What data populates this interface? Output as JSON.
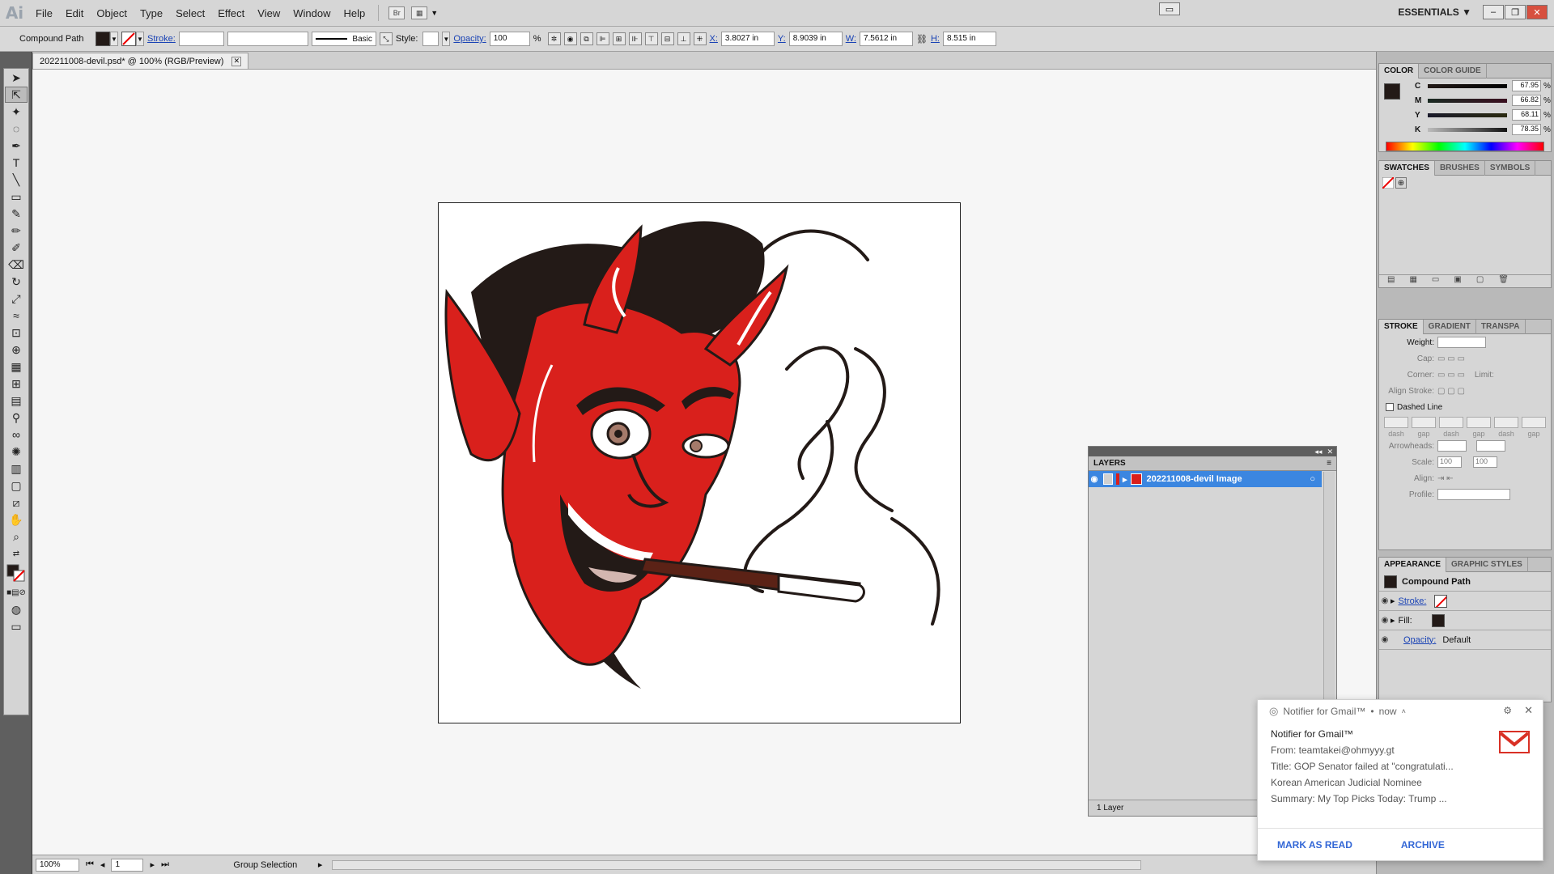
{
  "menubar": {
    "logo": "Ai",
    "items": [
      "File",
      "Edit",
      "Object",
      "Type",
      "Select",
      "Effect",
      "View",
      "Window",
      "Help"
    ],
    "bridge_label": "Br",
    "workspace": "ESSENTIALS"
  },
  "controlbar": {
    "selection_label": "Compound Path",
    "stroke_label": "Stroke:",
    "brush_label": "Basic",
    "style_label": "Style:",
    "opacity_label": "Opacity:",
    "opacity_value": "100",
    "opacity_unit": "%",
    "x_label": "X:",
    "x_value": "3.8027 in",
    "y_label": "Y:",
    "y_value": "8.9039 in",
    "w_label": "W:",
    "w_value": "7.5612 in",
    "h_label": "H:",
    "h_value": "8.515 in"
  },
  "document": {
    "tab_title": "202211008-devil.psd* @ 100% (RGB/Preview)"
  },
  "color_panel": {
    "tabs": [
      "COLOR",
      "COLOR GUIDE"
    ],
    "channels": [
      {
        "label": "C",
        "value": "67.95"
      },
      {
        "label": "M",
        "value": "66.82"
      },
      {
        "label": "Y",
        "value": "68.11"
      },
      {
        "label": "K",
        "value": "78.35"
      }
    ],
    "unit": "%"
  },
  "swatches_panel": {
    "tabs": [
      "SWATCHES",
      "BRUSHES",
      "SYMBOLS"
    ]
  },
  "stroke_panel": {
    "tabs": [
      "STROKE",
      "GRADIENT",
      "TRANSPA"
    ],
    "weight_label": "Weight:",
    "cap_label": "Cap:",
    "corner_label": "Corner:",
    "limit_label": "Limit:",
    "align_label": "Align Stroke:",
    "dashed_label": "Dashed Line",
    "dash_labels": [
      "dash",
      "gap",
      "dash",
      "gap",
      "dash",
      "gap"
    ],
    "arrowheads_label": "Arrowheads:",
    "scale_label": "Scale:",
    "scale_value_1": "100",
    "scale_value_2": "100",
    "align2_label": "Align:",
    "profile_label": "Profile:"
  },
  "appearance_panel": {
    "tabs": [
      "APPEARANCE",
      "GRAPHIC STYLES"
    ],
    "title": "Compound Path",
    "stroke_label": "Stroke:",
    "fill_label": "Fill:",
    "opacity_label": "Opacity:",
    "opacity_value": "Default"
  },
  "layers_panel": {
    "title": "LAYERS",
    "layer_name": "202211008-devil Image",
    "footer": "1 Layer"
  },
  "statusbar": {
    "zoom": "100%",
    "artboard": "1",
    "tool": "Group Selection"
  },
  "notification": {
    "app": "Notifier for Gmail™",
    "time": "now",
    "title": "Notifier for Gmail™",
    "from": "From: teamtakei@ohmyyy.gt",
    "subject": "Title: GOP Senator failed at \"congratulati...",
    "line3": "Korean American Judicial Nominee",
    "summary": "Summary: My Top Picks Today: Trump ...",
    "action1": "MARK AS READ",
    "action2": "ARCHIVE"
  },
  "colors": {
    "devil_red": "#d9201c",
    "dark": "#231a17",
    "cigar": "#5b2216",
    "selection": "#3b86e0",
    "link_blue": "#1a43b5",
    "gmail_red": "#d93025"
  }
}
